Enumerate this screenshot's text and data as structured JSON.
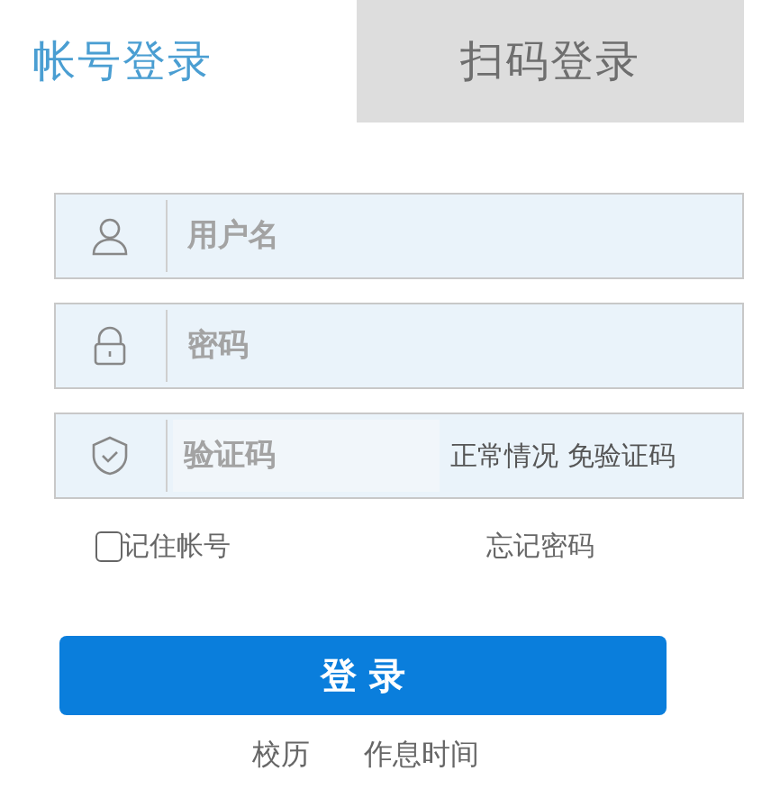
{
  "tabs": [
    {
      "label": "帐号登录",
      "selected": true
    },
    {
      "label": "扫码登录",
      "selected": false
    }
  ],
  "fields": [
    {
      "kind": "user",
      "placeholder": "用户名"
    },
    {
      "kind": "lock",
      "placeholder": "密码"
    },
    {
      "kind": "shield",
      "placeholder": "验证码",
      "note": "正常情况 免验证码"
    }
  ],
  "remember": {
    "label": "记住帐号",
    "checked": false
  },
  "forgot": "忘记密码",
  "login_button": "登 录",
  "footer_links": [
    "校历",
    "作息时间"
  ]
}
